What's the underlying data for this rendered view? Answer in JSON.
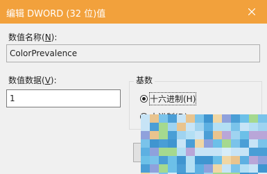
{
  "window": {
    "title": "编辑 DWORD (32 位)值",
    "close_icon": "close-icon"
  },
  "value_name": {
    "label_prefix": "数值名称(",
    "label_hotkey": "N",
    "label_suffix": "):",
    "value": "ColorPrevalence"
  },
  "value_data": {
    "label_prefix": "数值数据(",
    "label_hotkey": "V",
    "label_suffix": "):",
    "value": "1"
  },
  "base": {
    "title": "基数",
    "options": [
      {
        "label": "十六进制(H)",
        "selected": true
      },
      {
        "label": "十进制(D)",
        "selected": false
      }
    ]
  },
  "colors": {
    "titlebar": "#f2a13c",
    "window_bg": "#f0f0f0"
  }
}
